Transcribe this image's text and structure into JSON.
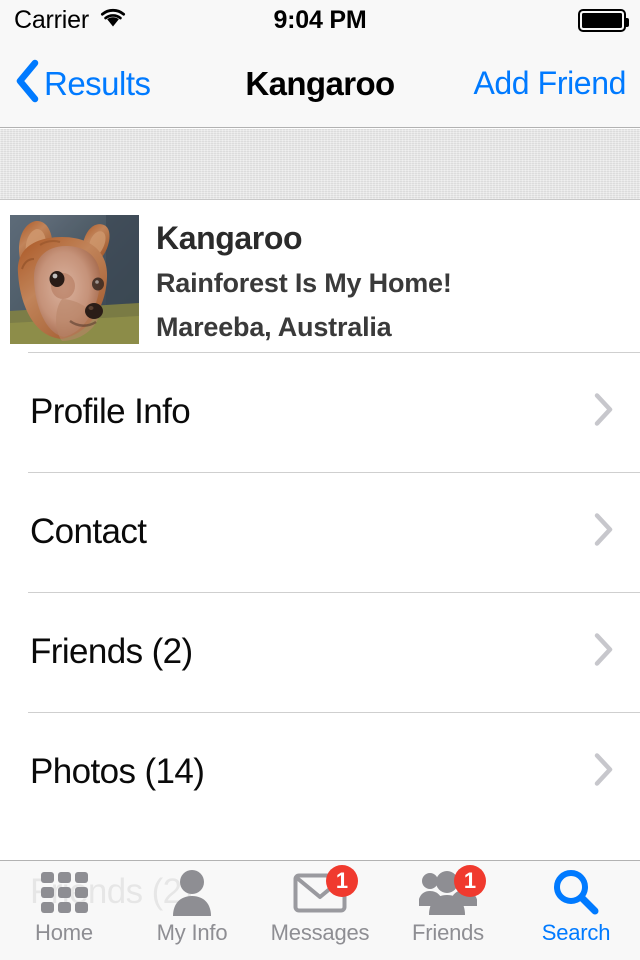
{
  "status_bar": {
    "carrier": "Carrier",
    "wifi_icon": "wifi-icon",
    "time": "9:04 PM",
    "battery_icon": "battery-full-icon"
  },
  "nav_bar": {
    "back_icon": "chevron-left-icon",
    "back_label": "Results",
    "title": "Kangaroo",
    "action_label": "Add Friend",
    "tint_color": "#007aff"
  },
  "profile": {
    "avatar_name": "kangaroo-avatar-photo",
    "name": "Kangaroo",
    "tagline": "Rainforest Is My Home!",
    "location": "Mareeba, Australia"
  },
  "list": {
    "rows": [
      {
        "label": "Profile Info",
        "name": "row-profile-info",
        "disclosure_icon": "chevron-right-icon"
      },
      {
        "label": "Contact",
        "name": "row-contact",
        "disclosure_icon": "chevron-right-icon"
      },
      {
        "label": "Friends (2)",
        "name": "row-friends",
        "disclosure_icon": "chevron-right-icon"
      },
      {
        "label": "Photos (14)",
        "name": "row-photos",
        "disclosure_icon": "chevron-right-icon"
      }
    ],
    "obscured_row_label": "Friends (2)"
  },
  "tab_bar": {
    "items": [
      {
        "label": "Home",
        "icon": "grid-icon",
        "badge": null,
        "active": false
      },
      {
        "label": "My Info",
        "icon": "person-icon",
        "badge": null,
        "active": false
      },
      {
        "label": "Messages",
        "icon": "envelope-icon",
        "badge": "1",
        "active": false
      },
      {
        "label": "Friends",
        "icon": "people-icon",
        "badge": "1",
        "active": false
      },
      {
        "label": "Search",
        "icon": "magnifier-icon",
        "badge": null,
        "active": true
      }
    ],
    "active_color": "#007aff",
    "inactive_color": "#8e8e93",
    "badge_color": "#f03a2e"
  }
}
